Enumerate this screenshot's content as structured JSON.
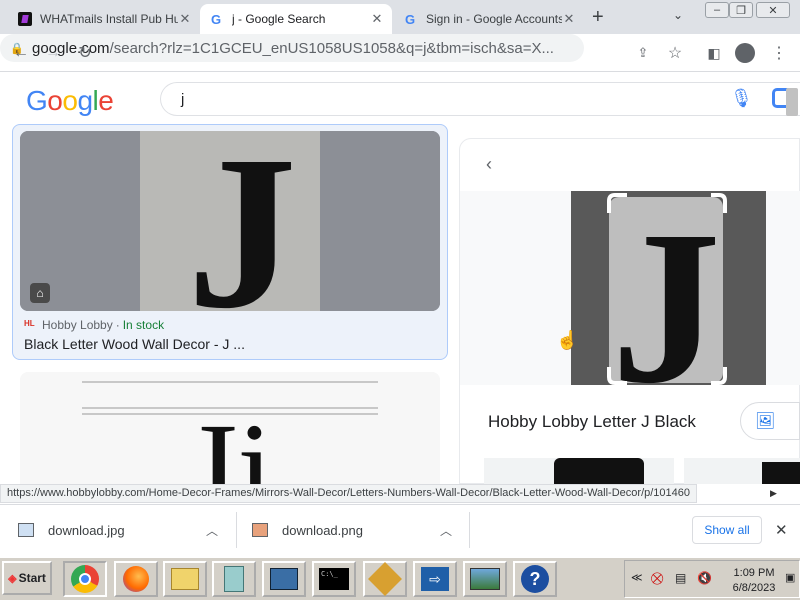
{
  "tabs": [
    {
      "title": "WHATmails Install Pub Hu",
      "icon": "whatmails-icon",
      "active": false
    },
    {
      "title": "j - Google Search",
      "icon": "google-icon",
      "active": true
    },
    {
      "title": "Sign in - Google Accounts",
      "icon": "google-icon",
      "active": false
    }
  ],
  "toolbar": {
    "url_domain": "google.com",
    "url_rest": "/search?rlz=1C1GCEU_enUS1058US1058&q=j&tbm=isch&sa=X..."
  },
  "google": {
    "logo": "Google",
    "query": "j"
  },
  "results": [
    {
      "source": "Hobby Lobby",
      "stock": "In stock",
      "title": "Black Letter Wood Wall Decor - J ...",
      "image_letter": "J"
    },
    {
      "image_text": "Ji"
    }
  ],
  "panel": {
    "title": "Hobby Lobby Letter J Black",
    "image_letter": "J"
  },
  "status_url": "https://www.hobbylobby.com/Home-Decor-Frames/Mirrors-Wall-Decor/Letters-Numbers-Wall-Decor/Black-Letter-Wood-Wall-Decor/p/101460",
  "downloads": [
    {
      "name": "download.jpg"
    },
    {
      "name": "download.png"
    }
  ],
  "show_all": "Show all",
  "taskbar": {
    "start": "Start",
    "time": "1:09 PM",
    "date": "6/8/2023"
  },
  "colors": {
    "accent": "#1a73e8",
    "stock_green": "#188038",
    "chrome_bg": "#dee1e6"
  }
}
